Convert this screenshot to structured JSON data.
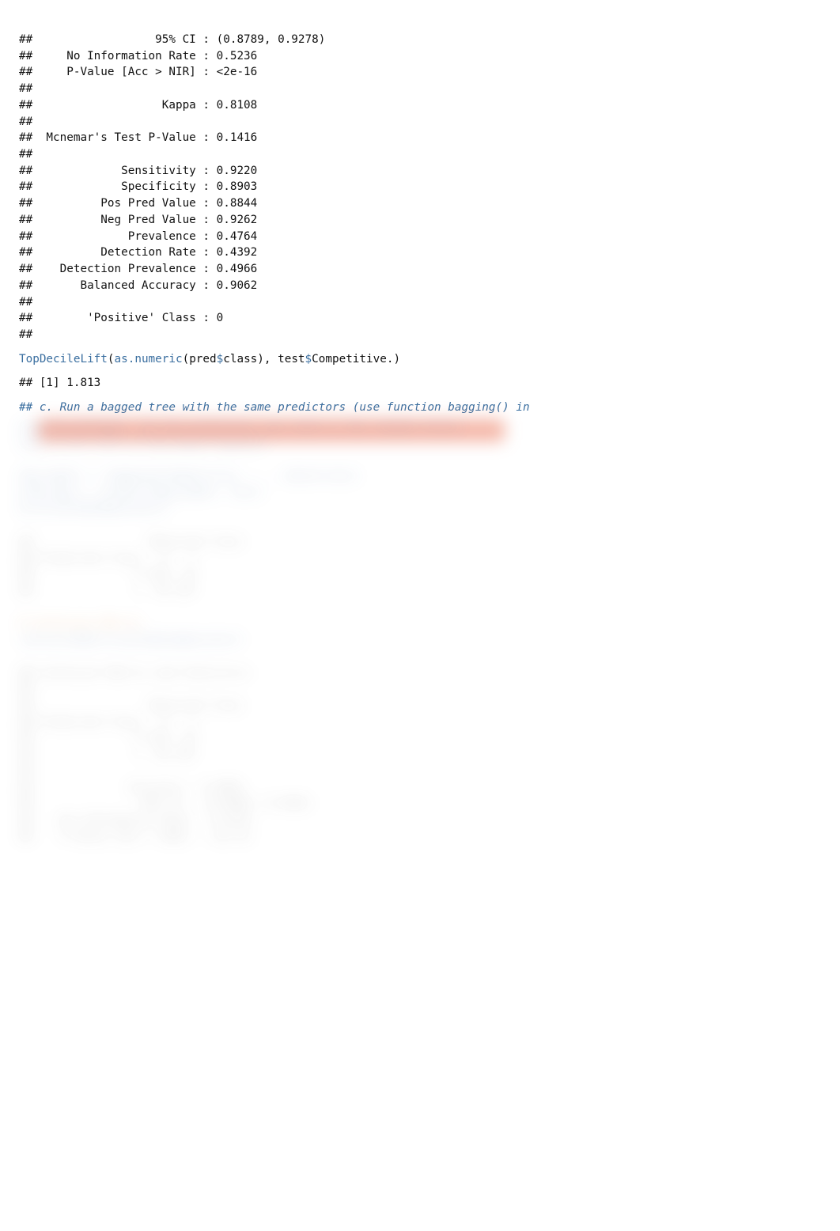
{
  "stats": {
    "ci_line": "##                  95% CI : (0.8789, 0.9278)",
    "nir_line": "##     No Information Rate : 0.5236",
    "pvalue_line": "##     P-Value [Acc > NIR] : <2e-16",
    "blank1": "## ",
    "kappa_line": "##                   Kappa : 0.8108",
    "blank2": "## ",
    "mcnemar_line": "##  Mcnemar's Test P-Value : 0.1416",
    "blank3": "## ",
    "sensitivity_line": "##             Sensitivity : 0.9220",
    "specificity_line": "##             Specificity : 0.8903",
    "pos_pred_line": "##          Pos Pred Value : 0.8844",
    "neg_pred_line": "##          Neg Pred Value : 0.9262",
    "prevalence_line": "##              Prevalence : 0.4764",
    "detection_rate_line": "##          Detection Rate : 0.4392",
    "detection_prev_line": "##    Detection Prevalence : 0.4966",
    "balanced_acc_line": "##       Balanced Accuracy : 0.9062",
    "blank4": "## ",
    "positive_class_line": "##        'Positive' Class : 0",
    "blank5": "## "
  },
  "code1": {
    "fn": "TopDecileLift",
    "open": "(",
    "asnum": "as.numeric",
    "p2": "(pred",
    "dollar1": "$",
    "class": "class), test",
    "dollar2": "$",
    "tail": "Competitive.)"
  },
  "out1": "## [1] 1.813",
  "comment_c": "## c. Run a bagged tree with the same predictors (use function bagging() in",
  "blur": {
    "l2": "bagging package). Do the predictors you used in the random forest",
    "l3": "have a fit lift in the data? Explain.",
    "l4": "",
    "l5": "bag_model <- bagging(Competitive. ~ ., data=train)",
    "l6": "pred_bag <- predict(bag_model, test)",
    "l7": "print(predSummarytest)",
    "l8": "",
    "l9": "##                 Observed Class",
    "l10": "## Predicted Class   0   1",
    "l11": "##               0 146  24",
    "l12": "##               1  38 187",
    "l13": "",
    "l14": "# Confusion Matrix",
    "l15": "confusionMatrix(pred$summarytest)",
    "l16": "",
    "l17": "## Confusion Matrix and Statistics",
    "l18": "##",
    "l19": "##                 Observed Class",
    "l20": "## Predicted Class   0   1",
    "l21": "##               0 146  24",
    "l22": "##               1  38 187",
    "l23": "##",
    "l24": "##              Accuracy : 0.8901",
    "l25": "##                95% CI : (0.8640, 0.9190)",
    "l26": "##    No Information Rate : 0.5270",
    "l27": "##    P-Value [Acc > NIR] : <2e-16"
  }
}
